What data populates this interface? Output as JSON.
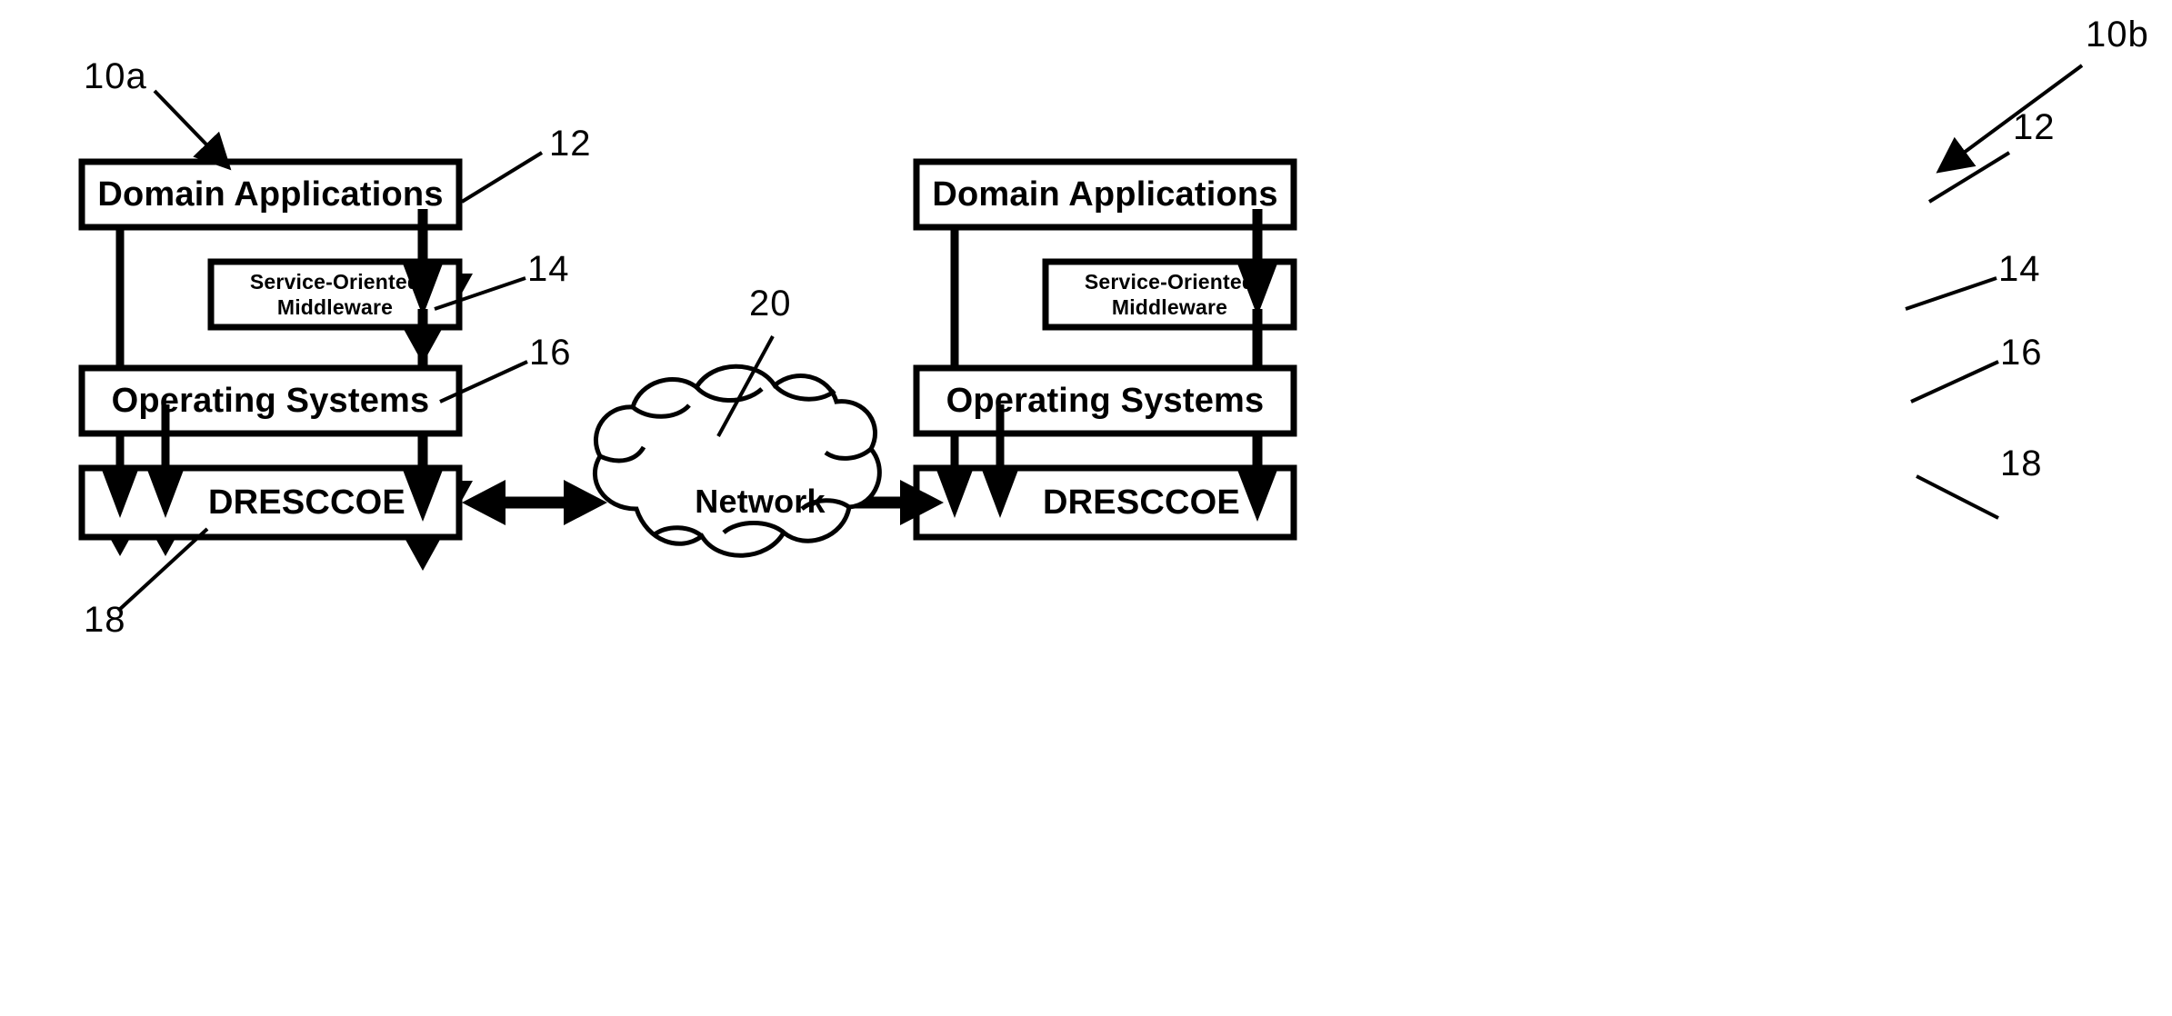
{
  "figure": {
    "type": "patent-block-diagram",
    "background_color": "#ffffff",
    "line_color": "#000000"
  },
  "nodes": {
    "left": {
      "ref": "10a",
      "domain_applications": "Domain Applications",
      "middleware": "Service-Oriented\nMiddleware",
      "operating_systems": "Operating Systems",
      "drescoe": "DRESCCOE"
    },
    "right": {
      "ref": "10b",
      "domain_applications": "Domain Applications",
      "middleware": "Service-Oriented\nMiddleware",
      "operating_systems": "Operating Systems",
      "drescoe": "DRESCCOE"
    },
    "network": {
      "label": "Network",
      "ref": "20"
    }
  },
  "reference_numerals": {
    "system_left": "10a",
    "system_right": "10b",
    "domain_applications_left": "12",
    "domain_applications_right": "12",
    "middleware_left": "14",
    "middleware_right": "14",
    "operating_systems_left": "16",
    "operating_systems_right": "16",
    "drescoe_left": "18",
    "drescoe_right": "18",
    "network": "20"
  }
}
